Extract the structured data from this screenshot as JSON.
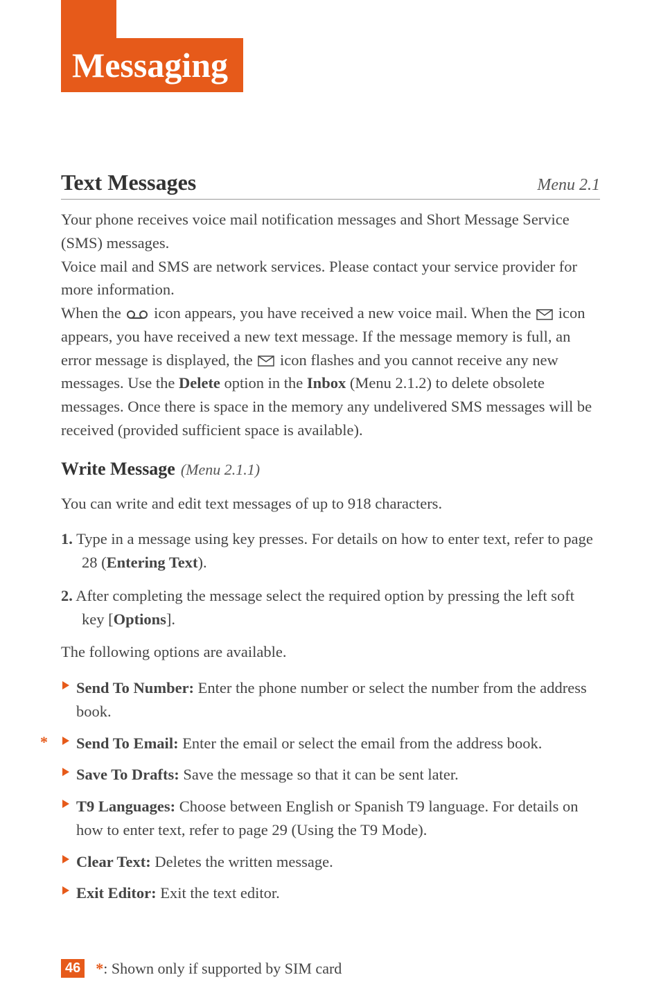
{
  "page": {
    "chapter_title": "Messaging",
    "page_number": "46"
  },
  "section": {
    "title": "Text Messages",
    "menu_ref": "Menu 2.1"
  },
  "intro": {
    "p1": "Your phone receives voice mail notification messages and Short Message Service (SMS) messages.",
    "p2": "Voice mail and SMS are network services. Please contact your service provider for more information.",
    "p3a": "When the ",
    "p3b": " icon appears, you have received a new voice mail. When the ",
    "p3c": " icon appears, you have received a new text message. If the message memory is full, an error message is displayed, the ",
    "p3d": " icon flashes and you cannot receive any new messages. Use the ",
    "p3e": "Delete",
    "p3f": " option in the ",
    "p3g": "Inbox",
    "p3h": " (Menu 2.1.2) to delete obsolete messages. Once there is space in the memory any undelivered SMS messages will be received (provided sufficient space is available)."
  },
  "subsection": {
    "title": "Write Message",
    "ref": "(Menu 2.1.1)",
    "intro": "You can write and edit text messages of up to 918 characters."
  },
  "steps": [
    {
      "num": "1.",
      "text_a": " Type in a message using key presses. For details on how to enter text, refer to page 28 (",
      "bold": "Entering Text",
      "text_b": ")."
    },
    {
      "num": "2.",
      "text_a": " After completing the message select the required option by pressing the left soft key [",
      "bold": "Options",
      "text_b": "]."
    }
  ],
  "options_intro": "The following options are available.",
  "options": [
    {
      "label": "Send To Number:",
      "desc": " Enter the phone number or select the number from the address book.",
      "asterisk": false
    },
    {
      "label": "Send To Email:",
      "desc": " Enter the email or select the email from the address book.",
      "asterisk": true
    },
    {
      "label": "Save To Drafts:",
      "desc": " Save the message so that it can be sent later.",
      "asterisk": false
    },
    {
      "label": "T9 Languages:",
      "desc": " Choose between English or Spanish T9 language. For details on how to enter text, refer to page 29 (Using the T9 Mode).",
      "asterisk": false
    },
    {
      "label": "Clear Text:",
      "desc": " Deletes the written message.",
      "asterisk": false
    },
    {
      "label": "Exit Editor:",
      "desc": " Exit the text editor.",
      "asterisk": false
    }
  ],
  "footnote": {
    "symbol": "*",
    "text": ": Shown only if supported by SIM card"
  }
}
